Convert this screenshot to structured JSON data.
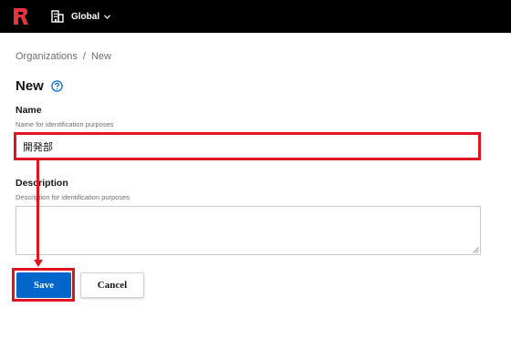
{
  "header": {
    "org_selector_label": "Global",
    "logo_icon": "brand-logo-icon",
    "org_icon": "building-icon",
    "dropdown_icon": "chevron-down-icon"
  },
  "breadcrumb": {
    "items": [
      "Organizations",
      "New"
    ],
    "separator": "/"
  },
  "page": {
    "title": "New",
    "help_icon": "question-circle-icon"
  },
  "form": {
    "name": {
      "label": "Name",
      "help": "Name for identification purposes",
      "value": "開発部"
    },
    "description": {
      "label": "Description",
      "help": "Description for identification purposes",
      "value": ""
    },
    "save_label": "Save",
    "cancel_label": "Cancel"
  },
  "colors": {
    "topbar": "#000000",
    "primary": "#0066cc",
    "annotation": "#e0141e",
    "logo": "#e8323c"
  }
}
